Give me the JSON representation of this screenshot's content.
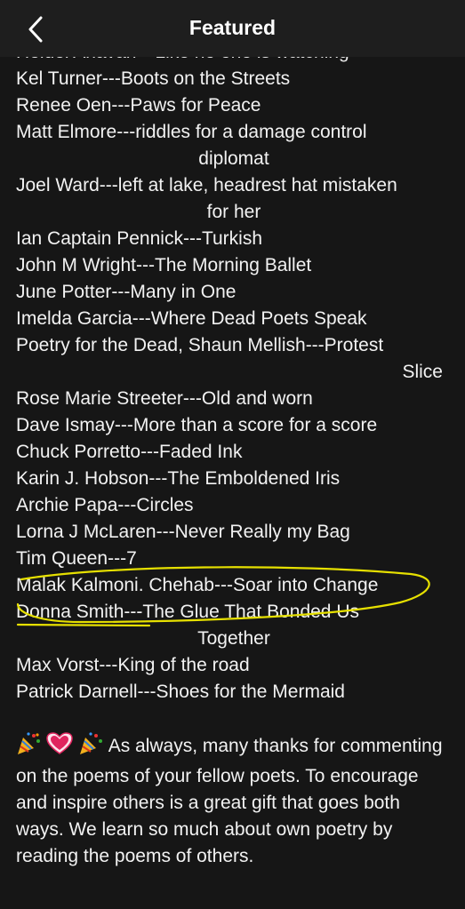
{
  "header": {
    "title": "Featured"
  },
  "partial_top_line": "Heidel Anavan---Like no one is watching",
  "entries": [
    {
      "author": "Kel Turner",
      "title": "Boots on the Streets"
    },
    {
      "author": "Renee Oen",
      "title": "Paws for Peace"
    },
    {
      "author": "Matt Elmore",
      "title": "riddles for a damage control",
      "title_cont": "diplomat"
    },
    {
      "author": "Joel Ward",
      "title": "left at lake, headrest hat mistaken",
      "title_cont": "for her"
    },
    {
      "author": "Ian Captain Pennick",
      "title": "Turkish"
    },
    {
      "author": "John M Wright",
      "title": "The Morning Ballet"
    },
    {
      "author": "June Potter",
      "title": "Many in One"
    },
    {
      "author": "Imelda Garcia",
      "title": "Where Dead Poets Speak"
    },
    {
      "author": "Poetry for the Dead, Shaun Mellish",
      "title": "Protest",
      "title_cont": "Slice"
    },
    {
      "author": "Rose Marie Streeter",
      "title": "Old and worn"
    },
    {
      "author": "Dave Ismay",
      "title": "More than a score for a score"
    },
    {
      "author": "Chuck Porretto",
      "title": "Faded Ink"
    },
    {
      "author": "Karin J. Hobson",
      "title": "The Emboldened Iris"
    },
    {
      "author": "Archie Papa",
      "title": "Circles"
    },
    {
      "author": "Lorna J McLaren",
      "title": "Never Really my Bag"
    },
    {
      "author": "Tim Queen",
      "title": "7"
    },
    {
      "author": "Malak Kalmoni. Chehab",
      "title": "Soar into Change"
    },
    {
      "author": "Donna Smith",
      "title": "The Glue That Bonded Us",
      "title_cont": "Together"
    },
    {
      "author": "Max Vorst",
      "title": "King of the road"
    },
    {
      "author": "Patrick Darnell",
      "title": "Shoes for the Mermaid"
    }
  ],
  "separator": "---",
  "closing_text": "As always, many thanks for commenting on the poems of your fellow poets. To encourage and inspire others is a great gift that goes both ways. We learn so much about own poetry by reading the poems of others.",
  "colors": {
    "background": "#161616",
    "text": "#f2f2f2",
    "highlight": "#e6e000"
  },
  "icons": [
    "back-chevron-icon",
    "party-popper-icon",
    "heart-icon"
  ]
}
